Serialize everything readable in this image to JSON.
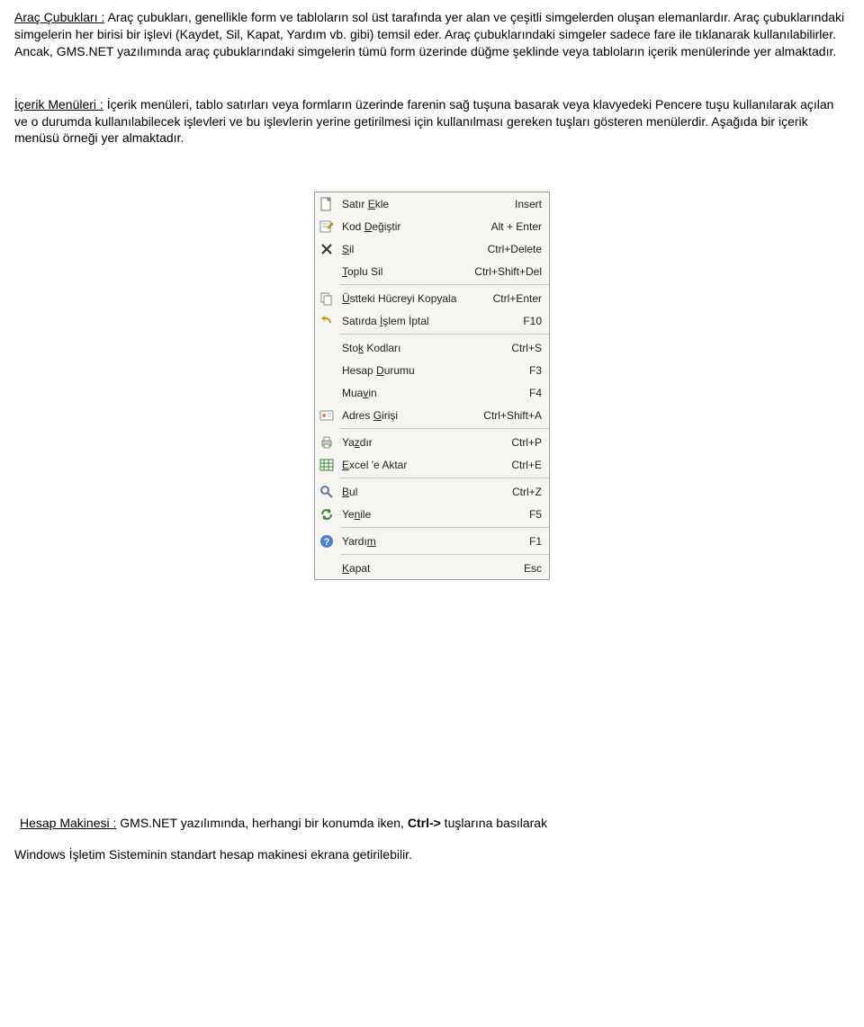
{
  "para1": {
    "title": "Araç Çubukları :",
    "text": " Araç çubukları, genellikle form ve tabloların sol üst tarafında yer alan ve çeşitli simgelerden oluşan elemanlardır. Araç çubuklarındaki simgelerin her birisi bir işlevi (Kaydet, Sil, Kapat, Yardım vb. gibi) temsil eder. Araç çubuklarındaki simgeler sadece fare ile tıklanarak kullanılabilirler. Ancak, GMS.NET yazılımında araç çubuklarındaki simgelerin tümü form üzerinde düğme şeklinde veya tabloların içerik menülerinde yer almaktadır."
  },
  "para2": {
    "title": "İçerik Menüleri :",
    "text": "  İçerik menüleri, tablo satırları veya formların üzerinde farenin sağ tuşuna basarak veya klavyedeki Pencere  tuşu kullanılarak açılan ve o durumda kullanılabilecek işlevleri ve bu işlevlerin yerine getirilmesi için kullanılması gereken tuşları gösteren menülerdir. Aşağıda bir içerik menüsü örneği yer almaktadır."
  },
  "menu": {
    "items": [
      {
        "label_pre": "Satır ",
        "u": "E",
        "label_post": "kle",
        "shortcut": "Insert",
        "icon": "new"
      },
      {
        "label_pre": "Kod ",
        "u": "D",
        "label_post": "eğiştir",
        "shortcut": "Alt + Enter",
        "icon": "edit"
      },
      {
        "label_pre": "",
        "u": "S",
        "label_post": "il",
        "shortcut": "Ctrl+Delete",
        "icon": "delete"
      },
      {
        "label_pre": "",
        "u": "T",
        "label_post": "oplu Sil",
        "shortcut": "Ctrl+Shift+Del",
        "icon": ""
      },
      {
        "sep": true
      },
      {
        "label_pre": "",
        "u": "Ü",
        "label_post": "stteki Hücreyi Kopyala",
        "shortcut": "Ctrl+Enter",
        "icon": "copy"
      },
      {
        "label_pre": "Satırda ",
        "u": "İ",
        "label_post": "şlem İptal",
        "shortcut": "F10",
        "icon": "undo"
      },
      {
        "sep": true
      },
      {
        "label_pre": "Sto",
        "u": "k",
        "label_post": " Kodları",
        "shortcut": "Ctrl+S",
        "icon": ""
      },
      {
        "label_pre": "Hesap ",
        "u": "D",
        "label_post": "urumu",
        "shortcut": "F3",
        "icon": ""
      },
      {
        "label_pre": "Mua",
        "u": "v",
        "label_post": "in",
        "shortcut": "F4",
        "icon": ""
      },
      {
        "label_pre": "Adres ",
        "u": "G",
        "label_post": "irişi",
        "shortcut": "Ctrl+Shift+A",
        "icon": "address"
      },
      {
        "sep": true
      },
      {
        "label_pre": "Ya",
        "u": "z",
        "label_post": "dır",
        "shortcut": "Ctrl+P",
        "icon": "print"
      },
      {
        "label_pre": "",
        "u": "E",
        "label_post": "xcel 'e Aktar",
        "shortcut": "Ctrl+E",
        "icon": "excel"
      },
      {
        "sep": true
      },
      {
        "label_pre": "",
        "u": "B",
        "label_post": "ul",
        "shortcut": "Ctrl+Z",
        "icon": "find"
      },
      {
        "label_pre": "Ye",
        "u": "n",
        "label_post": "ile",
        "shortcut": "F5",
        "icon": "refresh"
      },
      {
        "sep": true
      },
      {
        "label_pre": "Yardı",
        "u": "m",
        "label_post": "",
        "shortcut": "F1",
        "icon": "help"
      },
      {
        "sep": true
      },
      {
        "label_pre": "",
        "u": "K",
        "label_post": "apat",
        "shortcut": "Esc",
        "icon": ""
      }
    ]
  },
  "bottom": {
    "title": "Hesap Makinesi :",
    "text1_a": "  GMS.NET yazılımında, herhangi bir konumda iken, ",
    "text1_bold": "Ctrl->",
    "text1_b": " tuşlarına basılarak",
    "text2": "Windows İşletim Sisteminin standart hesap makinesi ekrana getirilebilir."
  }
}
